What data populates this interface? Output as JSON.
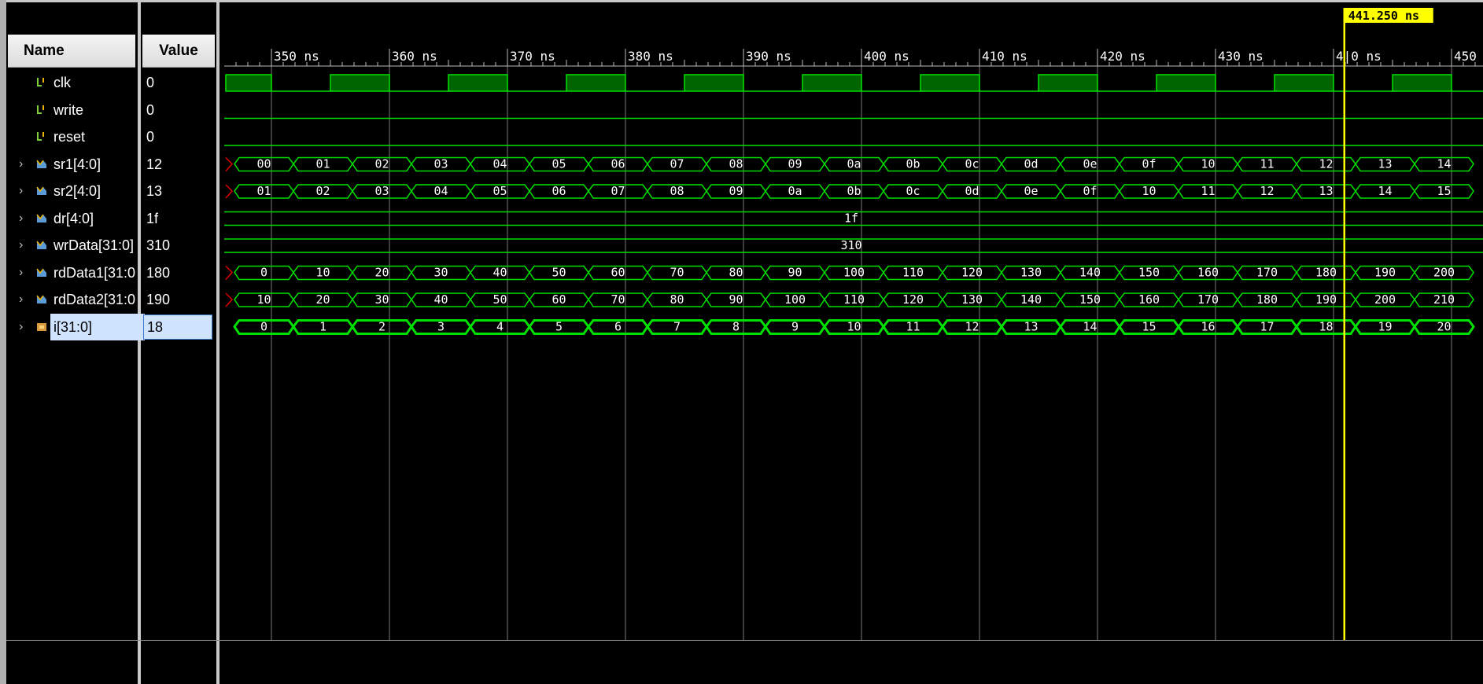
{
  "columns": {
    "name": "Name",
    "value": "Value"
  },
  "cursor": {
    "label": "441.250 ns"
  },
  "ruler": {
    "ticks": [
      "350 ns",
      "360 ns",
      "370 ns",
      "380 ns",
      "390 ns",
      "400 ns",
      "410 ns",
      "420 ns",
      "430 ns",
      "4|0 ns",
      "450"
    ]
  },
  "signals": [
    {
      "name": "clk",
      "value": "0",
      "kind": "bit",
      "expandable": false,
      "icon": "bit-signal-icon"
    },
    {
      "name": "write",
      "value": "0",
      "kind": "bit",
      "expandable": false,
      "icon": "bit-signal-icon"
    },
    {
      "name": "reset",
      "value": "0",
      "kind": "bit",
      "expandable": false,
      "icon": "bit-signal-icon"
    },
    {
      "name": "sr1[4:0]",
      "value": "12",
      "kind": "bus",
      "expandable": true,
      "icon": "bus-signal-icon",
      "segments": [
        "00",
        "01",
        "02",
        "03",
        "04",
        "05",
        "06",
        "07",
        "08",
        "09",
        "0a",
        "0b",
        "0c",
        "0d",
        "0e",
        "0f",
        "10",
        "11",
        "12",
        "13",
        "14"
      ]
    },
    {
      "name": "sr2[4:0]",
      "value": "13",
      "kind": "bus",
      "expandable": true,
      "icon": "bus-signal-icon",
      "segments": [
        "01",
        "02",
        "03",
        "04",
        "05",
        "06",
        "07",
        "08",
        "09",
        "0a",
        "0b",
        "0c",
        "0d",
        "0e",
        "0f",
        "10",
        "11",
        "12",
        "13",
        "14",
        "15"
      ]
    },
    {
      "name": "dr[4:0]",
      "value": "1f",
      "kind": "const",
      "expandable": true,
      "icon": "bus-signal-icon",
      "segments": [
        "1f"
      ]
    },
    {
      "name": "wrData[31:0]",
      "value": "310",
      "kind": "const",
      "expandable": true,
      "icon": "bus-signal-icon",
      "segments": [
        "310"
      ]
    },
    {
      "name": "rdData1[31:0",
      "value": "180",
      "kind": "bus",
      "expandable": true,
      "icon": "bus-signal-icon",
      "segments": [
        "0",
        "10",
        "20",
        "30",
        "40",
        "50",
        "60",
        "70",
        "80",
        "90",
        "100",
        "110",
        "120",
        "130",
        "140",
        "150",
        "160",
        "170",
        "180",
        "190",
        "200"
      ]
    },
    {
      "name": "rdData2[31:0",
      "value": "190",
      "kind": "bus",
      "expandable": true,
      "icon": "bus-signal-icon",
      "segments": [
        "10",
        "20",
        "30",
        "40",
        "50",
        "60",
        "70",
        "80",
        "90",
        "100",
        "110",
        "120",
        "130",
        "140",
        "150",
        "160",
        "170",
        "180",
        "190",
        "200",
        "210"
      ]
    },
    {
      "name": "i[31:0]",
      "value": "18",
      "kind": "bus-bold",
      "expandable": true,
      "icon": "variable-icon",
      "selected": true,
      "segments": [
        "0",
        "1",
        "2",
        "3",
        "4",
        "5",
        "6",
        "7",
        "8",
        "9",
        "10",
        "11",
        "12",
        "13",
        "14",
        "15",
        "16",
        "17",
        "18",
        "19",
        "20"
      ]
    }
  ],
  "colors": {
    "wave": "#00e000",
    "clk_fill": "#006400",
    "cursor": "#ffff00",
    "grid": "#7a7a7a",
    "glitch": "#e00000"
  }
}
